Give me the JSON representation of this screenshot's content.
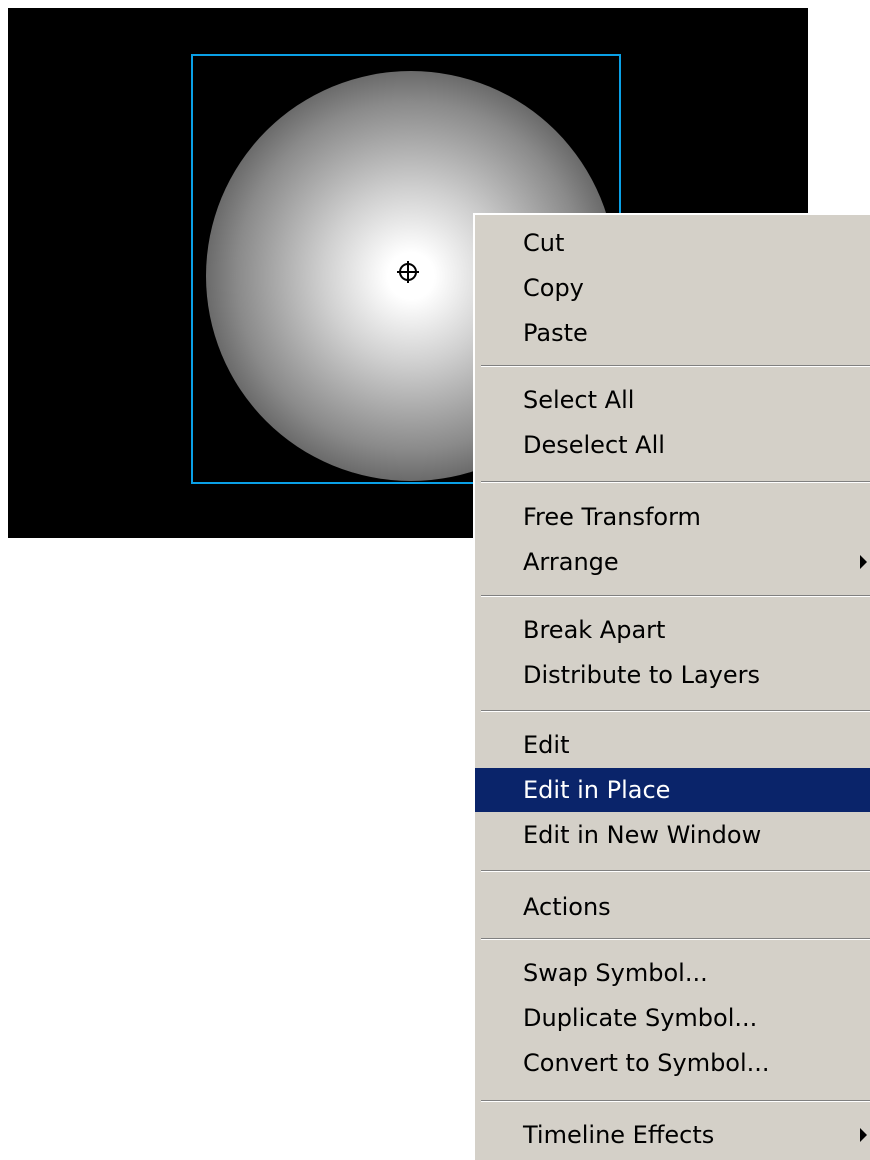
{
  "stage": {
    "background_color": "#000000",
    "selection_color": "#0aa0e6",
    "registration_icon": "crosshair-circle-icon"
  },
  "context_menu": {
    "background_color": "#d4d0c8",
    "highlight_color": "#0a246a",
    "highlighted_item": "Edit in Place",
    "groups": [
      [
        "Cut",
        "Copy",
        "Paste"
      ],
      [
        "Select All",
        "Deselect All"
      ],
      [
        "Free Transform",
        "Arrange"
      ],
      [
        "Break Apart",
        "Distribute to Layers"
      ],
      [
        "Edit",
        "Edit in Place",
        "Edit in New Window"
      ],
      [
        "Actions"
      ],
      [
        "Swap Symbol...",
        "Duplicate Symbol...",
        "Convert to Symbol..."
      ],
      [
        "Timeline Effects"
      ]
    ],
    "submenu_items": [
      "Arrange",
      "Timeline Effects"
    ],
    "submenu_icon": "triangle-right-icon"
  }
}
